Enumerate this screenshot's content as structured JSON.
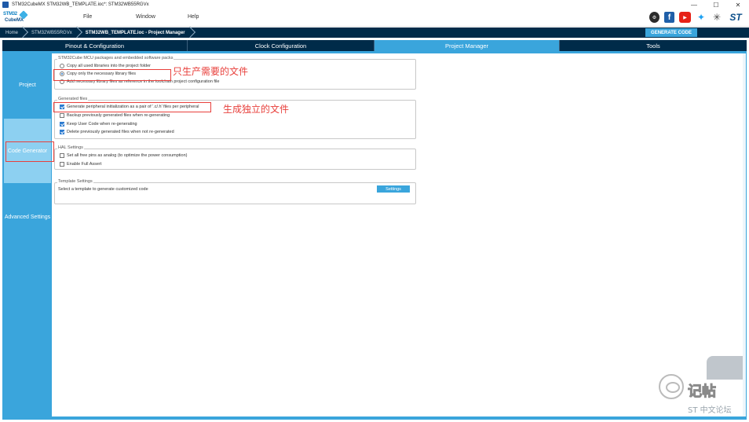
{
  "window": {
    "title": "STM32CubeMX STM32WB_TEMPLATE.ioc*: STM32WB55RGVx",
    "controls": [
      "—",
      "☐",
      "✕"
    ]
  },
  "logo": {
    "line1": "STM32",
    "line2": "CubeMX"
  },
  "menu": [
    "File",
    "Window",
    "Help"
  ],
  "breadcrumb": [
    "Home",
    "STM32WB55RGVx",
    "STM32WB_TEMPLATE.ioc - Project Manager"
  ],
  "generate_button": "GENERATE CODE",
  "tabs": [
    "Pinout & Configuration",
    "Clock Configuration",
    "Project Manager",
    "Tools"
  ],
  "active_tab": "Project Manager",
  "sidebar": [
    "Project",
    "Code Generator",
    "Advanced Settings"
  ],
  "active_sidebar": "Code Generator",
  "packs": {
    "title": "STM32Cube MCU packages and embedded software packs",
    "options": [
      "Copy all used libraries into the project folder",
      "Copy only the necessary library files",
      "Add necessary library files as reference in the toolchain project configuration file"
    ],
    "selected": 1
  },
  "generated": {
    "title": "Generated files",
    "options": [
      {
        "label": "Generate peripheral initialization as a pair of '.c/.h' files per peripheral",
        "checked": true
      },
      {
        "label": "Backup previously generated files when re-generating",
        "checked": false
      },
      {
        "label": "Keep User Code when re-generating",
        "checked": true
      },
      {
        "label": "Delete previously generated files when not re-generated",
        "checked": true
      }
    ]
  },
  "hal": {
    "title": "HAL Settings",
    "options": [
      {
        "label": "Set all free pins as analog (to optimize the power consumption)",
        "checked": false
      },
      {
        "label": "Enable Full Assert",
        "checked": false
      }
    ]
  },
  "template": {
    "title": "Template Settings",
    "text": "Select a template to generate customized code",
    "button": "Settings"
  },
  "annotations": {
    "note1": "只生产需要的文件",
    "note2": "生成独立的文件"
  },
  "watermark": {
    "line1": "记帖",
    "line2": "ST 中文论坛"
  },
  "colors": {
    "accent": "#3aa5dc",
    "navy": "#002b49",
    "annotation": "#e8403c"
  }
}
